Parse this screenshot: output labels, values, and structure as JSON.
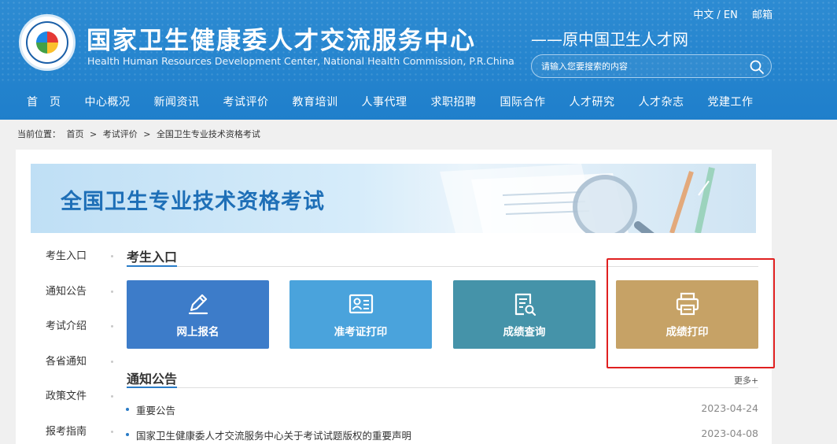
{
  "header": {
    "title_cn": "国家卫生健康委人才交流服务中心",
    "title_en": "Health Human Resources Development Center, National Health Commission, P.R.China",
    "subtitle": "——原中国卫生人才网",
    "lang_switch": "中文 / EN",
    "mail": "邮箱",
    "search_placeholder": "请输入您要搜索的内容"
  },
  "nav": {
    "items": [
      "首　页",
      "中心概况",
      "新闻资讯",
      "考试评价",
      "教育培训",
      "人事代理",
      "求职招聘",
      "国际合作",
      "人才研究",
      "人才杂志",
      "党建工作"
    ]
  },
  "breadcrumb": {
    "prefix": "当前位置：",
    "items": [
      "首页",
      "考试评价",
      "全国卫生专业技术资格考试"
    ],
    "separator": ">"
  },
  "banner": {
    "title": "全国卫生专业技术资格考试"
  },
  "sidebar": {
    "items": [
      "考生入口",
      "通知公告",
      "考试介绍",
      "各省通知",
      "政策文件",
      "报考指南"
    ]
  },
  "entrance": {
    "title": "考生入口",
    "tiles": [
      {
        "label": "网上报名",
        "icon": "pencil-icon",
        "color": "#3d7cc9"
      },
      {
        "label": "准考证打印",
        "icon": "id-card-icon",
        "color": "#4aa3dc"
      },
      {
        "label": "成绩查询",
        "icon": "document-search-icon",
        "color": "#4593a9"
      },
      {
        "label": "成绩打印",
        "icon": "printer-icon",
        "color": "#c6a266"
      }
    ]
  },
  "notices": {
    "title": "通知公告",
    "more": "更多+",
    "items": [
      {
        "title": "重要公告",
        "date": "2023-04-24"
      },
      {
        "title": "国家卫生健康委人才交流服务中心关于考试试题版权的重要声明",
        "date": "2023-04-08"
      }
    ]
  },
  "colors": {
    "header_blue": "#1f7fcb",
    "accent": "#2a7cc7",
    "highlight": "#e02020"
  }
}
